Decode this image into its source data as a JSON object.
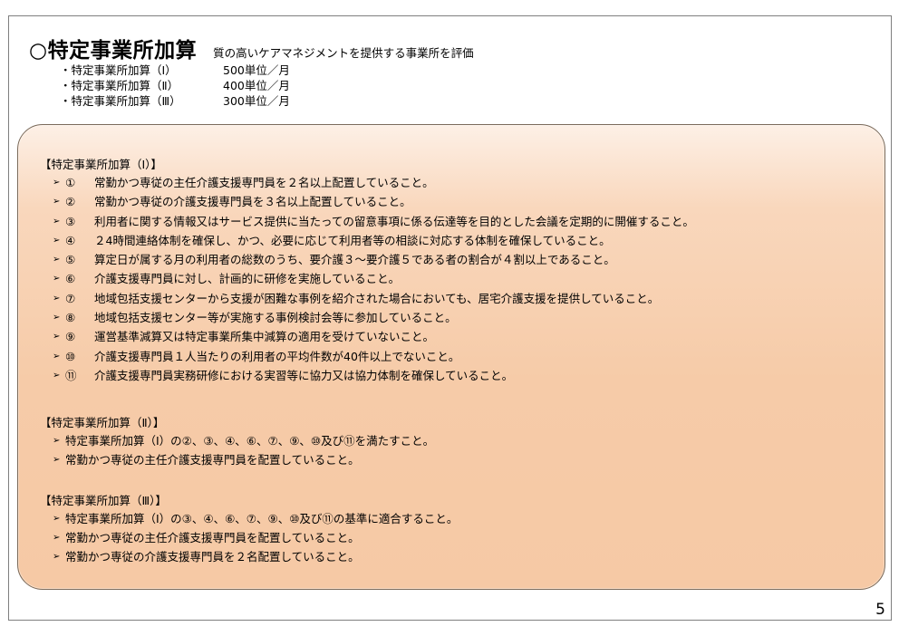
{
  "title": "○特定事業所加算",
  "subtitle": "質の高いケアマネジメントを提供する事業所を評価",
  "levels": [
    {
      "name": "・特定事業所加算（Ⅰ）",
      "value": "500単位／月"
    },
    {
      "name": "・特定事業所加算（Ⅱ）",
      "value": "400単位／月"
    },
    {
      "name": "・特定事業所加算（Ⅲ）",
      "value": "300単位／月"
    }
  ],
  "arrow": "➢",
  "section1": {
    "heading": "【特定事業所加算（Ⅰ）】",
    "items": [
      {
        "num": "①",
        "text": "常勤かつ専従の主任介護支援専門員を２名以上配置していること。"
      },
      {
        "num": "②",
        "text": "常勤かつ専従の介護支援専門員を３名以上配置していること。"
      },
      {
        "num": "③",
        "text": "利用者に関する情報又はサービス提供に当たっての留意事項に係る伝達等を目的とした会議を定期的に開催すること。"
      },
      {
        "num": "④",
        "text": "２4時間連絡体制を確保し、かつ、必要に応じて利用者等の相談に対応する体制を確保していること。"
      },
      {
        "num": "⑤",
        "text": "算定日が属する月の利用者の総数のうち、要介護３～要介護５である者の割合が４割以上であること。"
      },
      {
        "num": "⑥",
        "text": "介護支援専門員に対し、計画的に研修を実施していること。"
      },
      {
        "num": "⑦",
        "text": "地域包括支援センターから支援が困難な事例を紹介された場合においても、居宅介護支援を提供していること。"
      },
      {
        "num": "⑧",
        "text": "地域包括支援センター等が実施する事例検討会等に参加していること。"
      },
      {
        "num": "⑨",
        "text": "運営基準減算又は特定事業所集中減算の適用を受けていないこと。"
      },
      {
        "num": "⑩",
        "text": "介護支援専門員１人当たりの利用者の平均件数が40件以上でないこと。"
      },
      {
        "num": "⑪",
        "text": "介護支援専門員実務研修における実習等に協力又は協力体制を確保していること。"
      }
    ]
  },
  "section2": {
    "heading": "【特定事業所加算（Ⅱ）】",
    "items": [
      "特定事業所加算（Ⅰ）の②、③、④、⑥、⑦、⑨、⑩及び⑪を満たすこと。",
      "常勤かつ専従の主任介護支援専門員を配置していること。"
    ]
  },
  "section3": {
    "heading": "【特定事業所加算（Ⅲ）】",
    "items": [
      "特定事業所加算（Ⅰ）の③、④、⑥、⑦、⑨、⑩及び⑪の基準に適合すること。",
      "常勤かつ専従の主任介護支援専門員を配置していること。",
      "常勤かつ専従の介護支援専門員を２名配置していること。"
    ]
  },
  "page_number": "5",
  "colors": {
    "panel_fill": "#f6c9a5",
    "panel_border": "#7a6a5a"
  }
}
